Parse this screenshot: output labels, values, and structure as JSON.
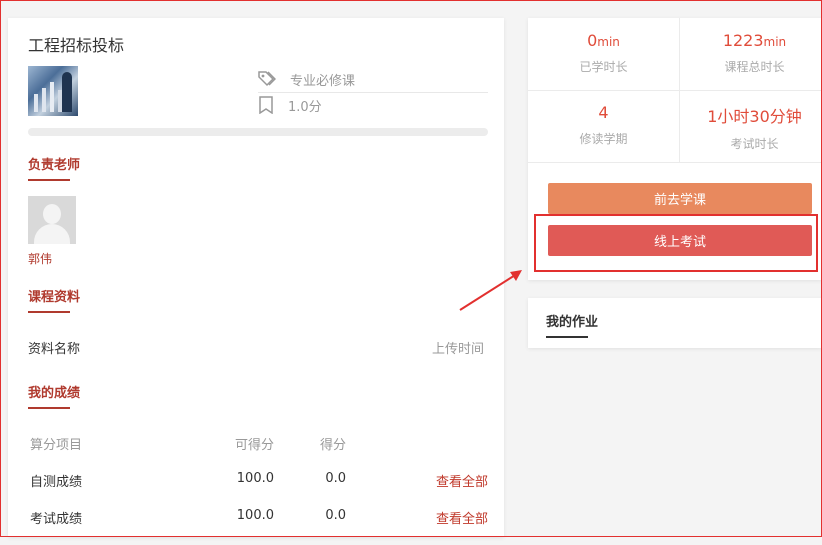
{
  "course": {
    "title": "工程招标投标",
    "tag": "专业必修课",
    "credit": "1.0分",
    "progress_percent": 0
  },
  "teacher_section": {
    "heading": "负责老师",
    "teacher_name": "郭伟"
  },
  "materials_section": {
    "heading": "课程资料",
    "col_name": "资料名称",
    "col_time": "上传时间"
  },
  "scores_section": {
    "heading": "我的成绩",
    "headers": {
      "item": "算分项目",
      "available": "可得分",
      "got": "得分"
    },
    "rows": [
      {
        "item": "自测成绩",
        "available": "100.0",
        "got": "0.0",
        "link": "查看全部"
      },
      {
        "item": "考试成绩",
        "available": "100.0",
        "got": "0.0",
        "link": "查看全部"
      }
    ]
  },
  "stats": {
    "studied": {
      "value": "0",
      "unit": "min",
      "label": "已学时长"
    },
    "total": {
      "value": "1223",
      "unit": "min",
      "label": "课程总时长"
    },
    "semester": {
      "value": "4",
      "label": "修读学期"
    },
    "exam_time": {
      "value": "1小时30分钟",
      "label": "考试时长"
    }
  },
  "buttons": {
    "study": "前去学课",
    "exam": "线上考试"
  },
  "homework": {
    "heading": "我的作业"
  },
  "colors": {
    "accent_red": "#e04c3a",
    "study_button": "#e8895e",
    "exam_button": "#e05a56",
    "section_heading": "#b03a2e"
  }
}
